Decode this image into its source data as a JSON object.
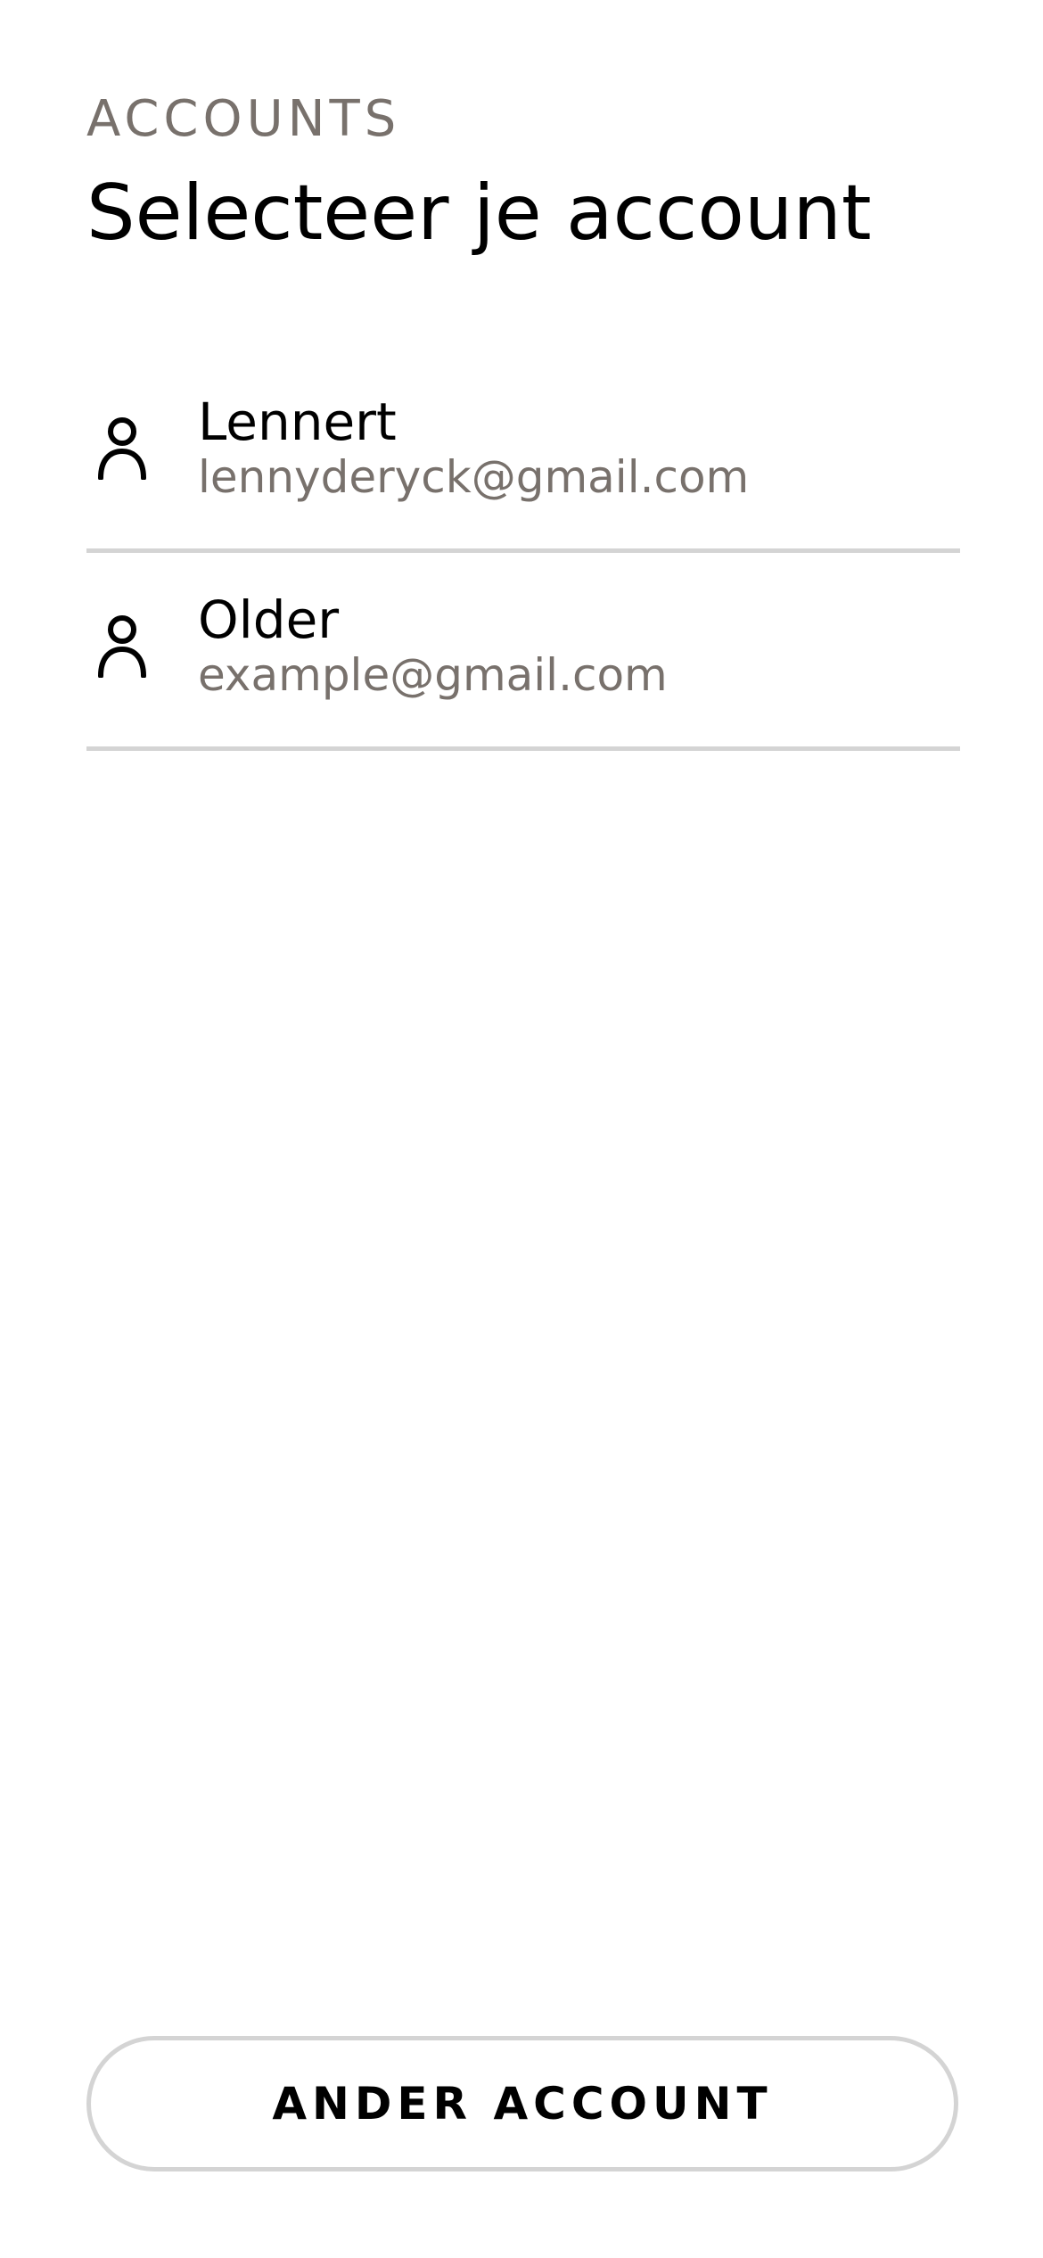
{
  "header": {
    "overline": "ACCOUNTS",
    "title": "Selecteer je account"
  },
  "accounts": [
    {
      "name": "Lennert",
      "email": "lennyderyck@gmail.com",
      "icon": "user-icon"
    },
    {
      "name": "Older",
      "email": "example@gmail.com",
      "icon": "user-icon"
    }
  ],
  "footer": {
    "other_account_label": "ANDER ACCOUNT"
  },
  "colors": {
    "background": "#ffffff",
    "text": "#000000",
    "muted": "#78716c",
    "divider": "#d4d4d4"
  }
}
